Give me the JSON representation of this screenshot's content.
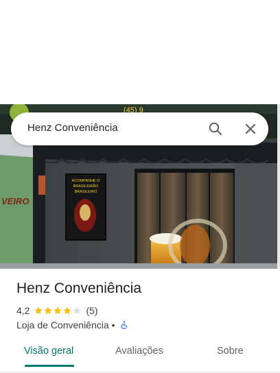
{
  "search": {
    "query": "Henz Conveniência"
  },
  "place": {
    "name": "Henz Conveniência",
    "rating": "4,2",
    "rating_fraction": 0.84,
    "reviews_count": "(5)",
    "category": "Loja de Conveniência",
    "separator": "•",
    "accessibility_icon": "wheelchair-icon"
  },
  "tabs": [
    {
      "label": "Visão geral",
      "active": true
    },
    {
      "label": "Avaliações",
      "active": false
    },
    {
      "label": "Sobre",
      "active": false
    }
  ],
  "photo": {
    "sign_text": "VEIRO",
    "poster_lines": [
      "ACOMPANHE O",
      "BRASILEIRÃO",
      "BRASILEIRO"
    ],
    "banner_text": "(45) 9"
  },
  "colors": {
    "accent": "#00796b",
    "star": "#fbbc04",
    "star_empty": "#dadce0"
  }
}
